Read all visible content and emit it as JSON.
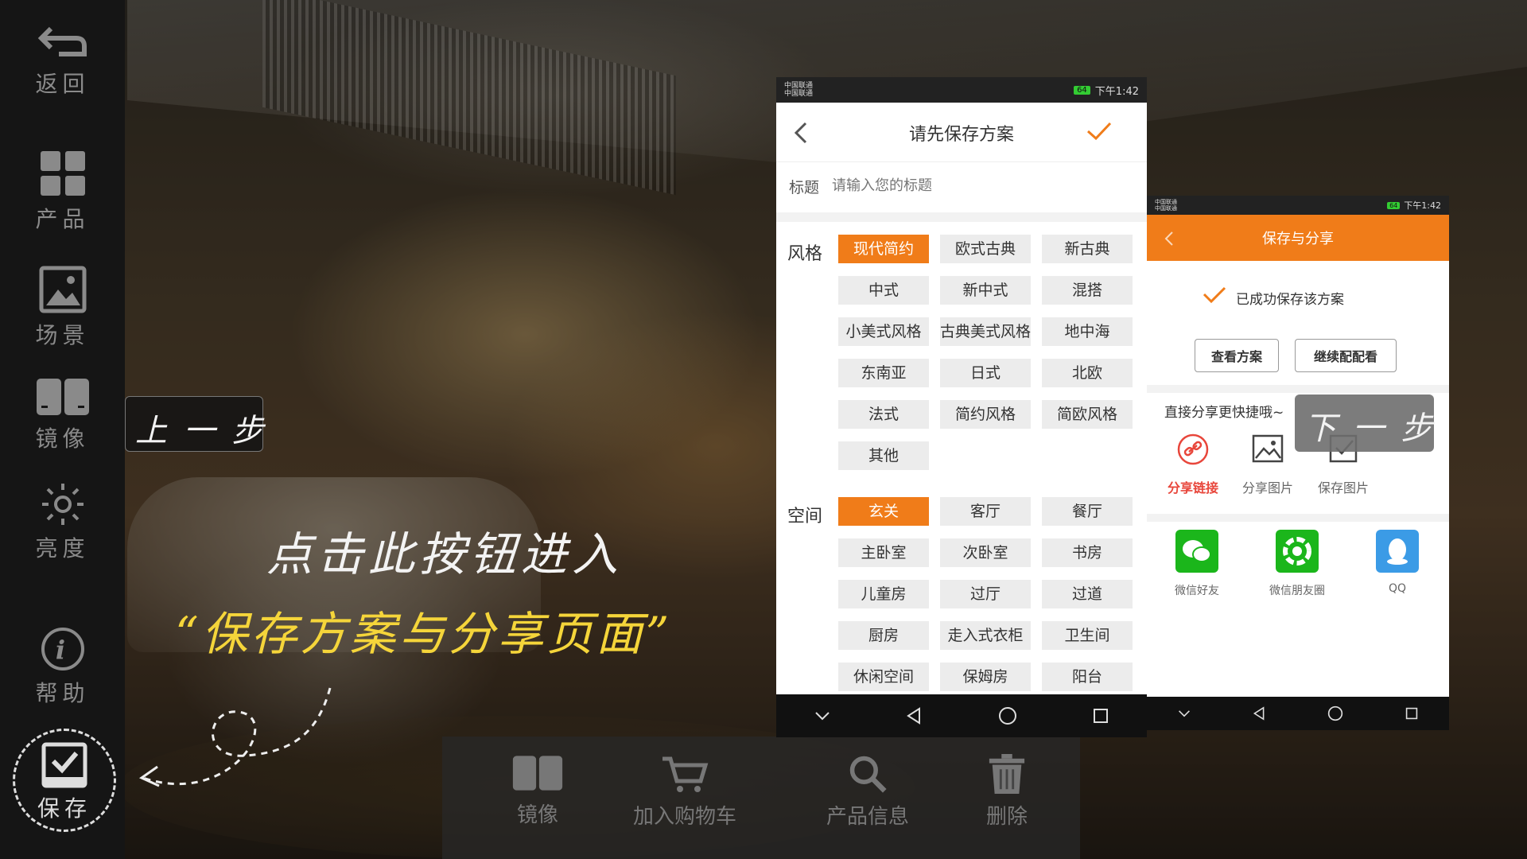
{
  "sidebar": {
    "back": "返回",
    "product": "产品",
    "scene": "场景",
    "mirror": "镜像",
    "brightness": "亮度",
    "help": "帮助",
    "save": "保存"
  },
  "bottombar": {
    "mirror": "镜像",
    "cart": "加入购物车",
    "info": "产品信息",
    "delete": "删除"
  },
  "captions": {
    "prev_step": "上 一 步",
    "next_step": "下 一 步",
    "line1": "点击此按钮进入",
    "line2": "“保存方案与分享页面”"
  },
  "phone1": {
    "status_carrier1": "中国联通",
    "status_carrier2": "中国联通",
    "status_time": "下午1:42",
    "status_battery": "64",
    "title": "请先保存方案",
    "field_label": "标题",
    "field_placeholder": "请输入您的标题",
    "style_label": "风格",
    "styles": [
      "现代简约",
      "欧式古典",
      "新古典",
      "中式",
      "新中式",
      "混搭",
      "小美式风格",
      "古典美式风格",
      "地中海",
      "东南亚",
      "日式",
      "北欧",
      "法式",
      "简约风格",
      "简欧风格",
      "其他"
    ],
    "space_label": "空间",
    "spaces": [
      "玄关",
      "客厅",
      "餐厅",
      "主卧室",
      "次卧室",
      "书房",
      "儿童房",
      "过厅",
      "过道",
      "厨房",
      "走入式衣柜",
      "卫生间",
      "休闲空间",
      "保姆房",
      "阳台"
    ]
  },
  "phone2": {
    "status_carrier1": "中国联通",
    "status_carrier2": "中国联通",
    "status_time": "下午1:42",
    "status_battery": "64",
    "title": "保存与分享",
    "success_text": "已成功保存该方案",
    "view_button": "查看方案",
    "continue_button": "继续配配看",
    "share_heading": "直接分享更快捷哦~",
    "share_link": "分享链接",
    "share_image": "分享图片",
    "save_image": "保存图片",
    "wechat_friends": "微信好友",
    "wechat_moments": "微信朋友圈",
    "qq": "QQ"
  },
  "colors": {
    "accent": "#f07c19",
    "caption_yellow": "#f5d53a",
    "link_red": "#e8463b",
    "wechat_green": "#1bb61b",
    "qq_blue": "#3b9be6"
  }
}
